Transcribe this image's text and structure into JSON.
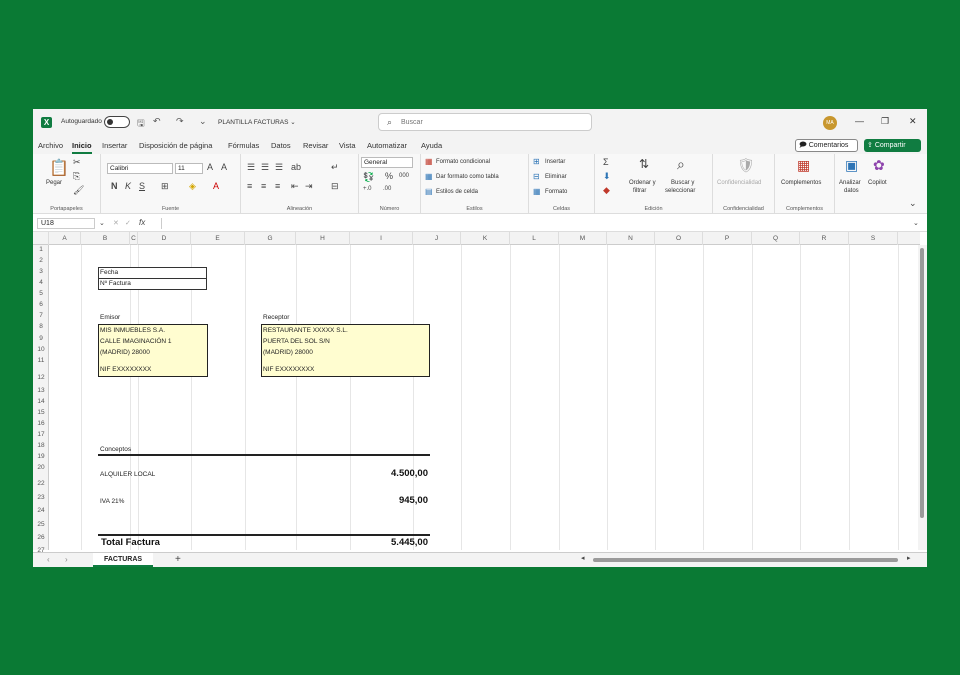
{
  "titlebar": {
    "autosave_label": "Autoguardado",
    "doc_title": "PLANTILLA FACTURAS ⌄",
    "search_placeholder": "Buscar",
    "avatar": "MA"
  },
  "menu": {
    "tabs": [
      "Archivo",
      "Inicio",
      "Insertar",
      "Disposición de página",
      "Fórmulas",
      "Datos",
      "Revisar",
      "Vista",
      "Automatizar",
      "Ayuda"
    ],
    "comments": "Comentarios",
    "share": "Compartir"
  },
  "ribbon": {
    "paste": "Pegar",
    "font_name": "Calibri",
    "font_size": "11",
    "number_format": "General",
    "cond_format": "Formato condicional",
    "table_format": "Dar formato como tabla",
    "cell_styles": "Estilos de celda",
    "insert": "Insertar",
    "delete": "Eliminar",
    "format": "Formato",
    "sort_filter_1": "Ordenar y",
    "sort_filter_2": "filtrar",
    "find_1": "Buscar y",
    "find_2": "seleccionar",
    "confidential": "Confidencialidad",
    "addins": "Complementos",
    "analyze_1": "Analizar",
    "analyze_2": "datos",
    "copilot": "Copilot",
    "groups": {
      "clipboard": "Portapapeles",
      "font": "Fuente",
      "alignment": "Alineación",
      "number": "Número",
      "styles": "Estilos",
      "cells": "Celdas",
      "editing": "Edición",
      "confidentiality": "Confidencialidad",
      "addins": "Complementos"
    }
  },
  "formula_bar": {
    "cell_ref": "U18",
    "fx": "fx"
  },
  "columns": [
    "A",
    "B",
    "C",
    "D",
    "E",
    "G",
    "H",
    "I",
    "J",
    "K",
    "L",
    "M",
    "N",
    "O",
    "P",
    "Q",
    "R",
    "S"
  ],
  "rows": [
    "1",
    "2",
    "3",
    "4",
    "5",
    "6",
    "7",
    "8",
    "9",
    "10",
    "11",
    "12",
    "13",
    "14",
    "15",
    "16",
    "17",
    "18",
    "19",
    "20",
    "22",
    "23",
    "24",
    "25",
    "26",
    "27"
  ],
  "invoice": {
    "fecha": "Fecha",
    "num_factura": "Nº Factura",
    "emisor_label": "Emisor",
    "receptor_label": "Receptor",
    "emisor": [
      "MIS INMUEBLES S.A.",
      "CALLE IMAGINACIÓN 1",
      "(MADRID) 28000",
      "NIF EXXXXXXXX"
    ],
    "receptor": [
      "RESTAURANTE XXXXX S.L.",
      "PUERTA DEL SOL S/N",
      "(MADRID) 28000",
      "NIF EXXXXXXXX"
    ],
    "conceptos": "Conceptos",
    "line1_label": "ALQUILER LOCAL",
    "line1_amount": "4.500,00",
    "line2_label": "IVA 21%",
    "line2_amount": "945,00",
    "total_label": "Total Factura",
    "total_amount": "5.445,00"
  },
  "sheets": {
    "active": "FACTURAS",
    "add": "+"
  }
}
